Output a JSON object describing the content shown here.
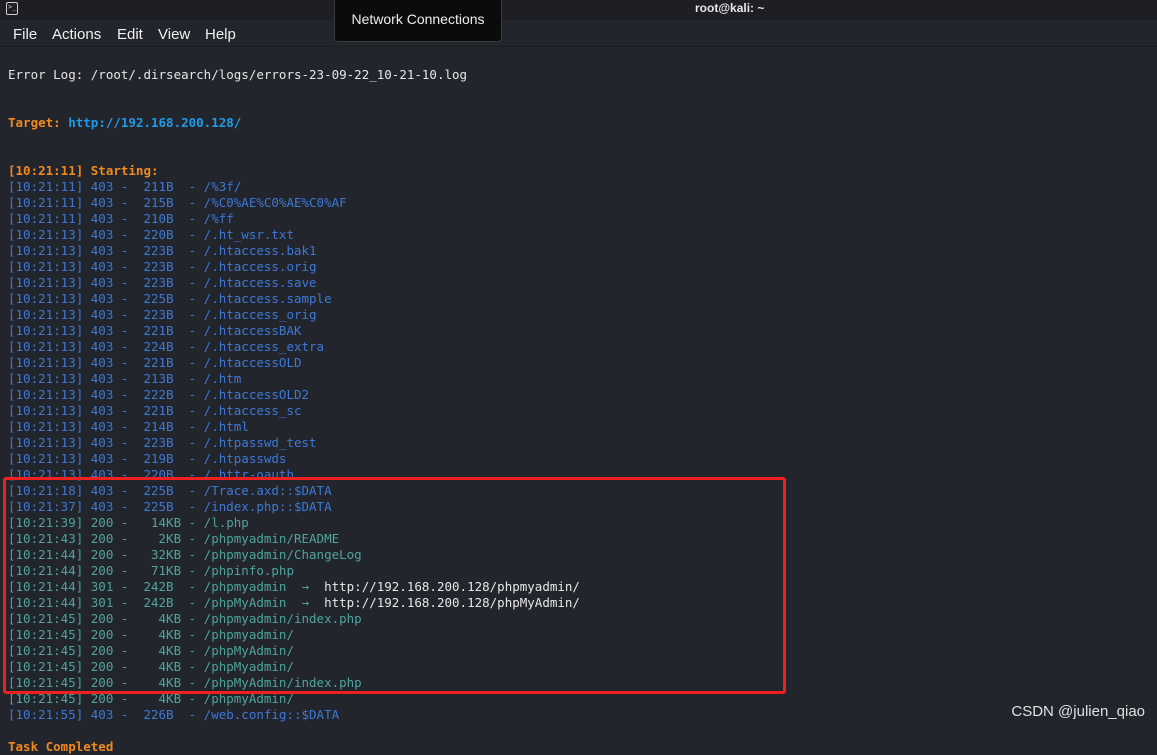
{
  "window": {
    "title": "root@kali: ~",
    "tooltip": "Network Connections"
  },
  "menu": [
    "File",
    "Actions",
    "Edit",
    "View",
    "Help"
  ],
  "error_log": "Error Log: /root/.dirsearch/logs/errors-23-09-22_10-21-10.log",
  "target_label": "Target:",
  "target_url": "http://192.168.200.128/",
  "starting": "[10:21:11] Starting:",
  "lines": [
    {
      "t": "[10:21:11] 403 -  211B  - /%3f/",
      "c": "b"
    },
    {
      "t": "[10:21:11] 403 -  215B  - /%C0%AE%C0%AE%C0%AF",
      "c": "b"
    },
    {
      "t": "[10:21:11] 403 -  210B  - /%ff",
      "c": "b"
    },
    {
      "t": "[10:21:13] 403 -  220B  - /.ht_wsr.txt",
      "c": "b"
    },
    {
      "t": "[10:21:13] 403 -  223B  - /.htaccess.bak1",
      "c": "b"
    },
    {
      "t": "[10:21:13] 403 -  223B  - /.htaccess.orig",
      "c": "b"
    },
    {
      "t": "[10:21:13] 403 -  223B  - /.htaccess.save",
      "c": "b"
    },
    {
      "t": "[10:21:13] 403 -  225B  - /.htaccess.sample",
      "c": "b"
    },
    {
      "t": "[10:21:13] 403 -  223B  - /.htaccess_orig",
      "c": "b"
    },
    {
      "t": "[10:21:13] 403 -  221B  - /.htaccessBAK",
      "c": "b"
    },
    {
      "t": "[10:21:13] 403 -  224B  - /.htaccess_extra",
      "c": "b"
    },
    {
      "t": "[10:21:13] 403 -  221B  - /.htaccessOLD",
      "c": "b"
    },
    {
      "t": "[10:21:13] 403 -  213B  - /.htm",
      "c": "b"
    },
    {
      "t": "[10:21:13] 403 -  222B  - /.htaccessOLD2",
      "c": "b"
    },
    {
      "t": "[10:21:13] 403 -  221B  - /.htaccess_sc",
      "c": "b"
    },
    {
      "t": "[10:21:13] 403 -  214B  - /.html",
      "c": "b"
    },
    {
      "t": "[10:21:13] 403 -  223B  - /.htpasswd_test",
      "c": "b"
    },
    {
      "t": "[10:21:13] 403 -  219B  - /.htpasswds",
      "c": "b"
    },
    {
      "t": "[10:21:13] 403 -  220B  - /.httr-oauth",
      "c": "b"
    },
    {
      "t": "[10:21:18] 403 -  225B  - /Trace.axd::$DATA",
      "c": "b"
    },
    {
      "t": "[10:21:37] 403 -  225B  - /index.php::$DATA",
      "c": "b"
    },
    {
      "t": "[10:21:39] 200 -   14KB - /l.php",
      "c": "g"
    },
    {
      "t": "[10:21:43] 200 -    2KB - /phpmyadmin/README",
      "c": "g"
    },
    {
      "t": "[10:21:44] 200 -   32KB - /phpmyadmin/ChangeLog",
      "c": "g"
    },
    {
      "t": "[10:21:44] 200 -   71KB - /phpinfo.php",
      "c": "g"
    },
    {
      "t": "[10:21:44] 301 -  242B  - /phpmyadmin  ->  ",
      "c": "g",
      "r": "http://192.168.200.128/phpmyadmin/"
    },
    {
      "t": "[10:21:44] 301 -  242B  - /phpMyAdmin  ->  ",
      "c": "g",
      "r": "http://192.168.200.128/phpMyAdmin/"
    },
    {
      "t": "[10:21:45] 200 -    4KB - /phpmyadmin/index.php",
      "c": "g"
    },
    {
      "t": "[10:21:45] 200 -    4KB - /phpmyadmin/",
      "c": "g"
    },
    {
      "t": "[10:21:45] 200 -    4KB - /phpMyAdmin/",
      "c": "g"
    },
    {
      "t": "[10:21:45] 200 -    4KB - /phpMyadmin/",
      "c": "g"
    },
    {
      "t": "[10:21:45] 200 -    4KB - /phpMyAdmin/index.php",
      "c": "g"
    },
    {
      "t": "[10:21:45] 200 -    4KB - /phpmyAdmin/",
      "c": "g"
    },
    {
      "t": "[10:21:55] 403 -  226B  - /web.config::$DATA",
      "c": "b"
    }
  ],
  "completed": "Task Completed",
  "watermark": "CSDN @julien_qiao",
  "colors": {
    "highlight_box": "#ef2020",
    "status_403": "#3c78d6",
    "status_200": "#4ea49c",
    "accent": "#f0891e"
  }
}
